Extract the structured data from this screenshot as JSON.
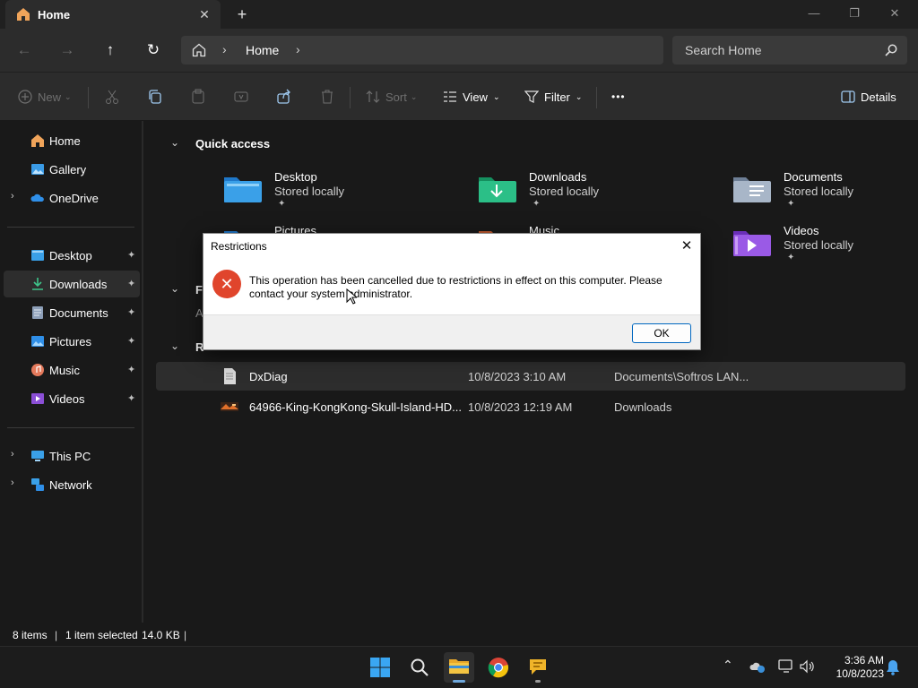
{
  "tab": {
    "title": "Home",
    "close": "✕",
    "new": "+"
  },
  "window": {
    "minimize": "—",
    "maximize": "❐",
    "close": "✕"
  },
  "nav": {
    "back": "←",
    "forward": "→",
    "up": "↑",
    "refresh": "↻",
    "breadcrumb": "Home",
    "separator": "›",
    "search_placeholder": "Search Home"
  },
  "commands": {
    "new": "New",
    "sort": "Sort",
    "view": "View",
    "filter": "Filter",
    "more": "•••",
    "details": "Details"
  },
  "sidebar": {
    "top": [
      {
        "label": "Home",
        "icon": "home-icon"
      },
      {
        "label": "Gallery",
        "icon": "gallery-icon"
      },
      {
        "label": "OneDrive",
        "icon": "onedrive-icon"
      }
    ],
    "pinned": [
      {
        "label": "Desktop",
        "icon": "desktop-folder-icon"
      },
      {
        "label": "Downloads",
        "icon": "downloads-folder-icon"
      },
      {
        "label": "Documents",
        "icon": "documents-folder-icon"
      },
      {
        "label": "Pictures",
        "icon": "pictures-folder-icon"
      },
      {
        "label": "Music",
        "icon": "music-folder-icon"
      },
      {
        "label": "Videos",
        "icon": "videos-folder-icon"
      }
    ],
    "bottom": [
      {
        "label": "This PC",
        "icon": "pc-icon"
      },
      {
        "label": "Network",
        "icon": "network-icon"
      }
    ],
    "pin_glyph": "📌"
  },
  "main": {
    "quick_access_title": "Quick access",
    "favorites_partial": "F",
    "favorites_sub_partial": "A",
    "recent_partial": "R",
    "folders": [
      {
        "name": "Desktop",
        "sub": "Stored locally"
      },
      {
        "name": "Downloads",
        "sub": "Stored locally"
      },
      {
        "name": "Documents",
        "sub": "Stored locally"
      },
      {
        "name": "Pictures",
        "sub": ""
      },
      {
        "name": "Music",
        "sub": ""
      },
      {
        "name": "Videos",
        "sub": "Stored locally"
      }
    ],
    "recent": [
      {
        "name": "DxDiag",
        "date": "10/8/2023 3:10 AM",
        "location": "Documents\\Softros LAN..."
      },
      {
        "name": "64966-King-KongKong-Skull-Island-HD...",
        "date": "10/8/2023 12:19 AM",
        "location": "Downloads"
      }
    ]
  },
  "status": {
    "items": "8 items",
    "selected": "1 item selected",
    "size": "14.0 KB"
  },
  "dialog": {
    "title": "Restrictions",
    "close": "✕",
    "message": "This operation has been cancelled due to restrictions in effect on this computer. Please contact your system administrator.",
    "ok": "OK",
    "icon": "✕"
  },
  "taskbar": {
    "time": "3:36 AM",
    "date": "10/8/2023"
  },
  "colors": {
    "accent": "#0067c0",
    "error": "#e0452c",
    "folder_blue": "#3aa0e8"
  }
}
